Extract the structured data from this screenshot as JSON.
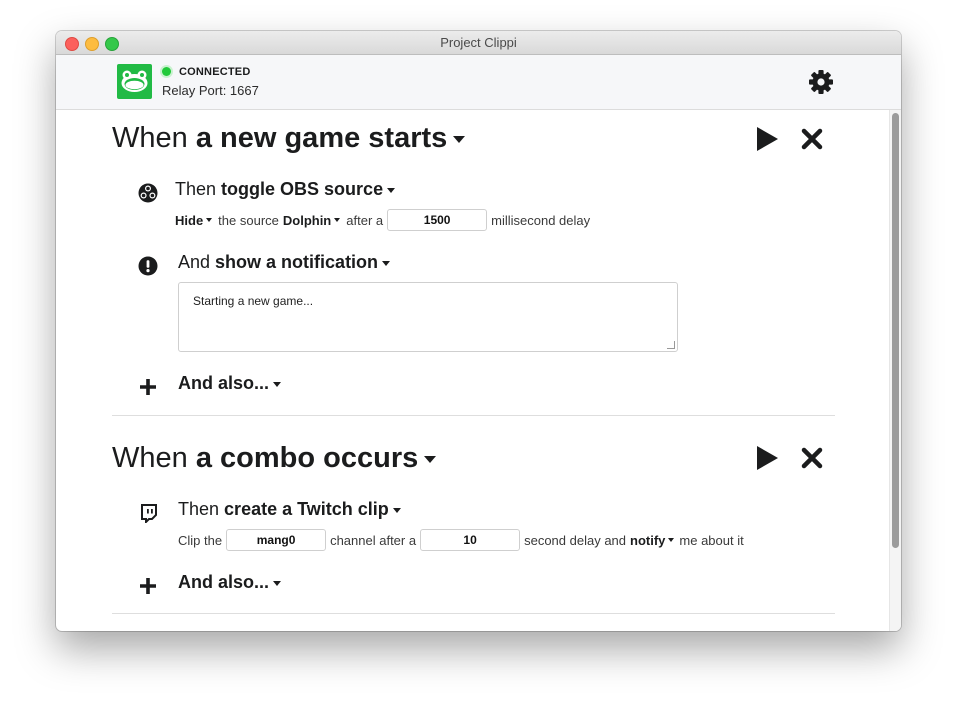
{
  "window": {
    "title": "Project Clippi"
  },
  "header": {
    "status": "CONNECTED",
    "relay_port": "Relay Port: 1667"
  },
  "events": [
    {
      "when": "When",
      "trigger": "a new game starts",
      "actions": [
        {
          "prefix": "Then",
          "name": "toggle OBS source",
          "icon": "obs-icon",
          "params": {
            "mode": "Hide",
            "text1": "the source",
            "source": "Dolphin",
            "text2": "after a",
            "delay": "1500",
            "text3": "millisecond delay"
          }
        },
        {
          "prefix": "And",
          "name": "show a notification",
          "icon": "exclamation-circle-icon",
          "message": "Starting a new game..."
        }
      ],
      "add_label": "And also..."
    },
    {
      "when": "When",
      "trigger": "a combo occurs",
      "actions": [
        {
          "prefix": "Then",
          "name": "create a Twitch clip",
          "icon": "twitch-icon",
          "params": {
            "text1": "Clip the",
            "channel": "mang0",
            "text2": "channel after a",
            "delay": "10",
            "text3": "second delay and",
            "notify": "notify",
            "text4": "me about it"
          }
        }
      ],
      "add_label": "And also..."
    }
  ],
  "colors": {
    "accent_green": "#21ba45",
    "status_dot": "#21c93a",
    "text": "#1b1c1d"
  }
}
